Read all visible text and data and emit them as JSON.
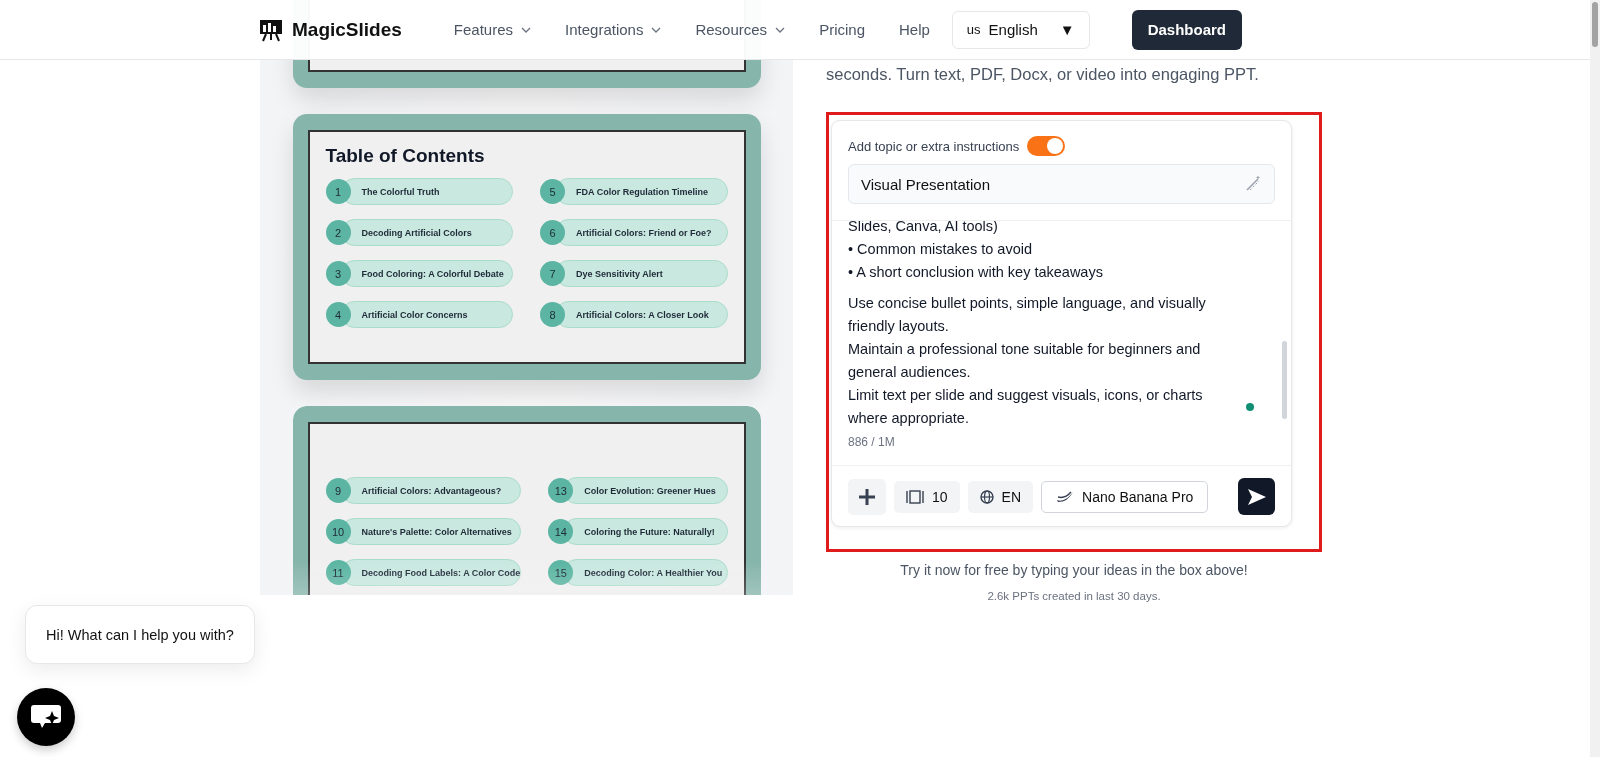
{
  "header": {
    "logo": "MagicSlides",
    "nav": [
      {
        "label": "Features",
        "dropdown": true
      },
      {
        "label": "Integrations",
        "dropdown": true
      },
      {
        "label": "Resources",
        "dropdown": true
      },
      {
        "label": "Pricing",
        "dropdown": false
      },
      {
        "label": "Help",
        "dropdown": false
      }
    ],
    "language": {
      "code": "us",
      "label": "English",
      "caret": "▼"
    },
    "cta": "Dashboard"
  },
  "slides_preview": {
    "cards": [
      {
        "faded": false
      },
      {
        "title": "Table of Contents",
        "faded": false,
        "items": [
          {
            "number": "1",
            "label": "The Colorful Truth"
          },
          {
            "number": "5",
            "label": "FDA Color Regulation Timeline"
          },
          {
            "number": "2",
            "label": "Decoding Artificial Colors"
          },
          {
            "number": "6",
            "label": "Artificial Colors: Friend or Foe?"
          },
          {
            "number": "3",
            "label": "Food Coloring: A Colorful Debate"
          },
          {
            "number": "7",
            "label": "Dye Sensitivity Alert"
          },
          {
            "number": "4",
            "label": "Artificial Color Concerns"
          },
          {
            "number": "8",
            "label": "Artificial Colors: A Closer Look"
          }
        ]
      },
      {
        "faded": true,
        "items": [
          {
            "number": "9",
            "label": "Artificial Colors: Advantageous?"
          },
          {
            "number": "13",
            "label": "Color Evolution: Greener Hues"
          },
          {
            "number": "10",
            "label": "Nature's Palette: Color Alternatives"
          },
          {
            "number": "14",
            "label": "Coloring the Future: Naturally!"
          },
          {
            "number": "11",
            "label": "Decoding Food Labels: A Color Code"
          },
          {
            "number": "15",
            "label": "Decoding Color: A Healthier You"
          }
        ]
      }
    ]
  },
  "intro": "seconds. Turn text, PDF, Docx, or video into engaging PPT.",
  "generator": {
    "toggle_label": "Add topic or extra instructions",
    "toggle_on": true,
    "topic": "Visual Presentation",
    "prompt_paragraphs": [
      [
        "Slides, Canva, AI tools)",
        "• Common mistakes to avoid",
        "• A short conclusion with key takeaways"
      ],
      [
        "Use concise bullet points, simple language, and visually friendly layouts.",
        "Maintain a professional tone suitable for beginners and general audiences.",
        "Limit text per slide and suggest visuals, icons, or charts where appropriate."
      ]
    ],
    "counter": "886 / 1M",
    "slide_count": "10",
    "language": "EN",
    "model": "Nano Banana Pro"
  },
  "cta_note": "Try it now for free by typing your ideas in the box above!",
  "stats": "2.6k PPTs created in last 30 days.",
  "chat": {
    "greeting": "Hi! What can I help you with?"
  }
}
